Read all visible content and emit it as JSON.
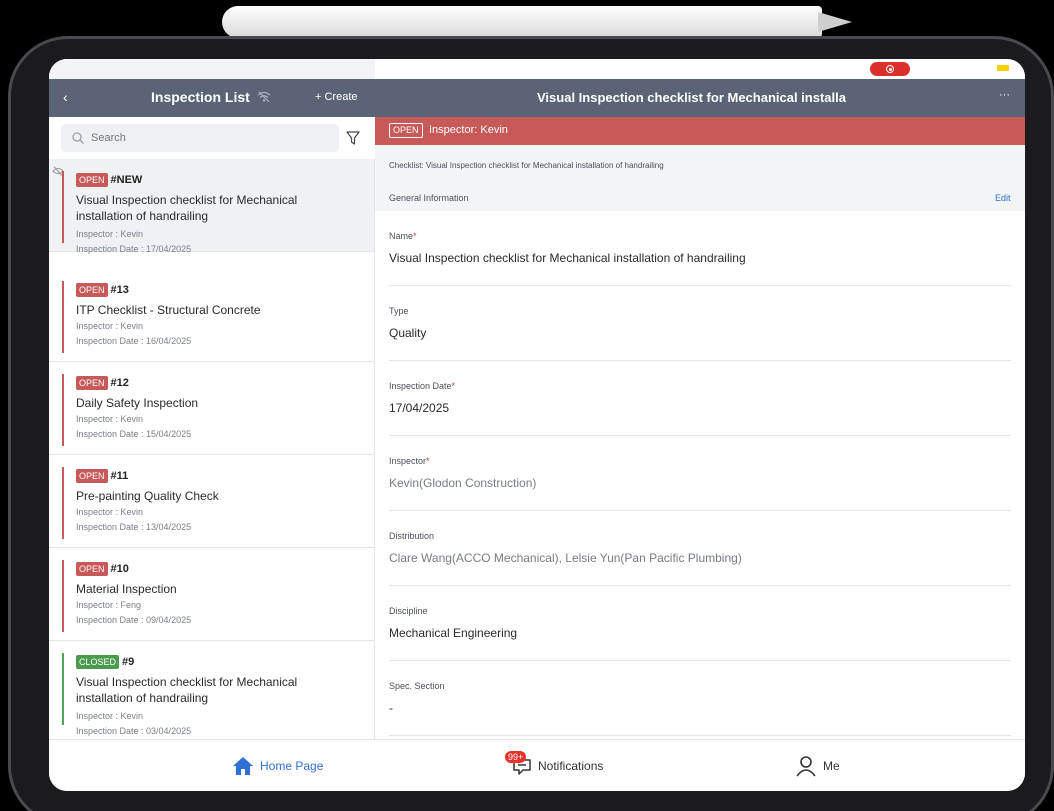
{
  "left_header": {
    "back": "‹",
    "title": "Inspection List",
    "create": "+ Create"
  },
  "search": {
    "placeholder": "Search"
  },
  "inspections": [
    {
      "status": "OPEN",
      "number": "#NEW",
      "title": "Visual Inspection checklist for Mechanical installation of handrailing",
      "inspector": "Inspector : Kevin",
      "date": "Inspection Date : 17/04/2025"
    },
    {
      "status": "OPEN",
      "number": "#13",
      "title": "ITP Checklist - Structural Concrete",
      "inspector": "Inspector : Kevin",
      "date": "Inspection Date : 16/04/2025"
    },
    {
      "status": "OPEN",
      "number": "#12",
      "title": "Daily Safety Inspection",
      "inspector": "Inspector : Kevin",
      "date": "Inspection Date : 15/04/2025"
    },
    {
      "status": "OPEN",
      "number": "#11",
      "title": "Pre-painting Quality Check",
      "inspector": "Inspector : Kevin",
      "date": "Inspection Date : 13/04/2025"
    },
    {
      "status": "OPEN",
      "number": "#10",
      "title": "Material Inspection",
      "inspector": "Inspector : Feng",
      "date": "Inspection Date : 09/04/2025"
    },
    {
      "status": "CLOSED",
      "number": "#9",
      "title": "Visual Inspection checklist for Mechanical installation of handrailing",
      "inspector": "Inspector : Kevin",
      "date": "Inspection Date : 03/04/2025"
    }
  ],
  "detail": {
    "title": "Visual Inspection checklist for Mechanical installa",
    "more": "···",
    "banner_badge": "OPEN",
    "banner_text": "Inspector: Kevin",
    "checklist": "Checklist: Visual Inspection checklist for Mechanical installation of handrailing",
    "general_info": "General Information",
    "edit": "Edit",
    "fields": [
      {
        "label": "Name",
        "required": "*",
        "value": "Visual Inspection checklist for Mechanical installation of handrailing"
      },
      {
        "label": "Type",
        "required": "",
        "value": "Quality"
      },
      {
        "label": "Inspection Date",
        "required": "*",
        "value": "17/04/2025"
      },
      {
        "label": "Inspector",
        "required": "*",
        "value": "Kevin(Glodon Construction)"
      },
      {
        "label": "Distribution",
        "required": "",
        "value": "Clare Wang(ACCO Mechanical), Lelsie Yun(Pan Pacific Plumbing)"
      },
      {
        "label": "Discipline",
        "required": "",
        "value": "Mechanical Engineering"
      },
      {
        "label": "Spec. Section",
        "required": "",
        "value": "-"
      }
    ]
  },
  "tabbar": {
    "home": "Home Page",
    "notifications": "Notifications",
    "notif_badge": "99+",
    "me": "Me"
  },
  "colors": {
    "header": "#5b6477",
    "open": "#c75a58",
    "closed": "#4a9a4f",
    "accent": "#2f6fd6"
  }
}
